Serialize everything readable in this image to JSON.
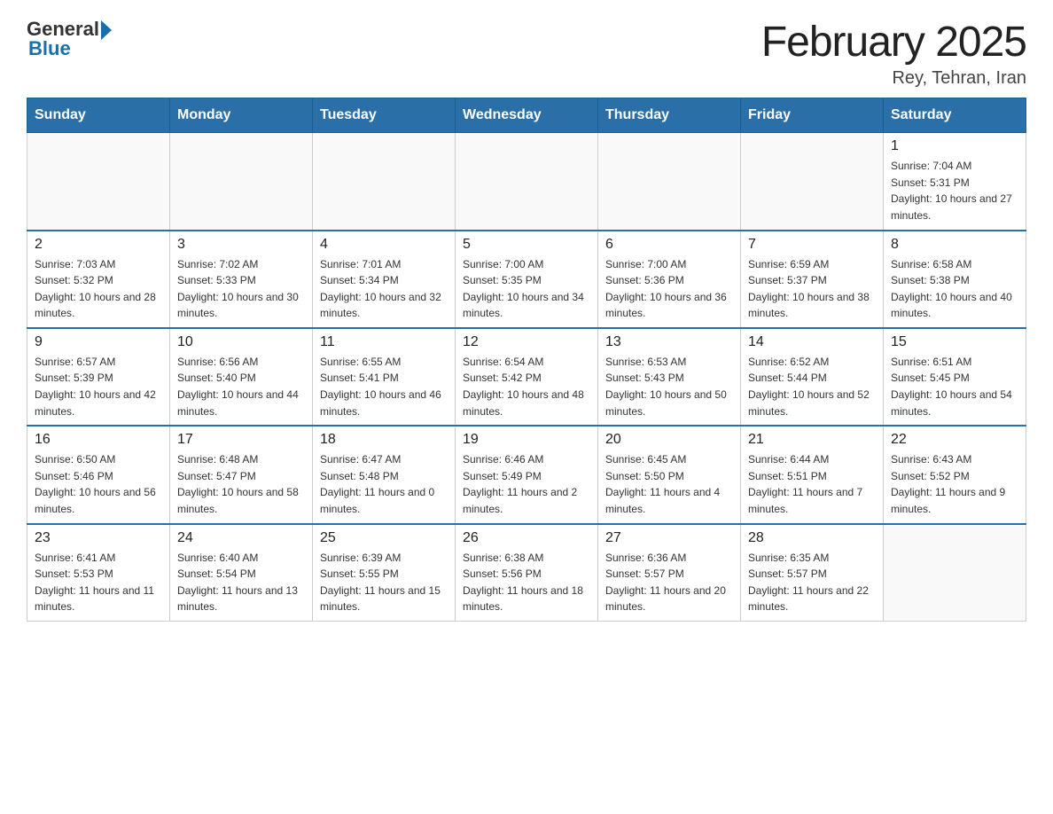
{
  "logo": {
    "general": "General",
    "blue": "Blue"
  },
  "title": "February 2025",
  "subtitle": "Rey, Tehran, Iran",
  "weekdays": [
    "Sunday",
    "Monday",
    "Tuesday",
    "Wednesday",
    "Thursday",
    "Friday",
    "Saturday"
  ],
  "weeks": [
    [
      {
        "day": "",
        "info": ""
      },
      {
        "day": "",
        "info": ""
      },
      {
        "day": "",
        "info": ""
      },
      {
        "day": "",
        "info": ""
      },
      {
        "day": "",
        "info": ""
      },
      {
        "day": "",
        "info": ""
      },
      {
        "day": "1",
        "info": "Sunrise: 7:04 AM\nSunset: 5:31 PM\nDaylight: 10 hours and 27 minutes."
      }
    ],
    [
      {
        "day": "2",
        "info": "Sunrise: 7:03 AM\nSunset: 5:32 PM\nDaylight: 10 hours and 28 minutes."
      },
      {
        "day": "3",
        "info": "Sunrise: 7:02 AM\nSunset: 5:33 PM\nDaylight: 10 hours and 30 minutes."
      },
      {
        "day": "4",
        "info": "Sunrise: 7:01 AM\nSunset: 5:34 PM\nDaylight: 10 hours and 32 minutes."
      },
      {
        "day": "5",
        "info": "Sunrise: 7:00 AM\nSunset: 5:35 PM\nDaylight: 10 hours and 34 minutes."
      },
      {
        "day": "6",
        "info": "Sunrise: 7:00 AM\nSunset: 5:36 PM\nDaylight: 10 hours and 36 minutes."
      },
      {
        "day": "7",
        "info": "Sunrise: 6:59 AM\nSunset: 5:37 PM\nDaylight: 10 hours and 38 minutes."
      },
      {
        "day": "8",
        "info": "Sunrise: 6:58 AM\nSunset: 5:38 PM\nDaylight: 10 hours and 40 minutes."
      }
    ],
    [
      {
        "day": "9",
        "info": "Sunrise: 6:57 AM\nSunset: 5:39 PM\nDaylight: 10 hours and 42 minutes."
      },
      {
        "day": "10",
        "info": "Sunrise: 6:56 AM\nSunset: 5:40 PM\nDaylight: 10 hours and 44 minutes."
      },
      {
        "day": "11",
        "info": "Sunrise: 6:55 AM\nSunset: 5:41 PM\nDaylight: 10 hours and 46 minutes."
      },
      {
        "day": "12",
        "info": "Sunrise: 6:54 AM\nSunset: 5:42 PM\nDaylight: 10 hours and 48 minutes."
      },
      {
        "day": "13",
        "info": "Sunrise: 6:53 AM\nSunset: 5:43 PM\nDaylight: 10 hours and 50 minutes."
      },
      {
        "day": "14",
        "info": "Sunrise: 6:52 AM\nSunset: 5:44 PM\nDaylight: 10 hours and 52 minutes."
      },
      {
        "day": "15",
        "info": "Sunrise: 6:51 AM\nSunset: 5:45 PM\nDaylight: 10 hours and 54 minutes."
      }
    ],
    [
      {
        "day": "16",
        "info": "Sunrise: 6:50 AM\nSunset: 5:46 PM\nDaylight: 10 hours and 56 minutes."
      },
      {
        "day": "17",
        "info": "Sunrise: 6:48 AM\nSunset: 5:47 PM\nDaylight: 10 hours and 58 minutes."
      },
      {
        "day": "18",
        "info": "Sunrise: 6:47 AM\nSunset: 5:48 PM\nDaylight: 11 hours and 0 minutes."
      },
      {
        "day": "19",
        "info": "Sunrise: 6:46 AM\nSunset: 5:49 PM\nDaylight: 11 hours and 2 minutes."
      },
      {
        "day": "20",
        "info": "Sunrise: 6:45 AM\nSunset: 5:50 PM\nDaylight: 11 hours and 4 minutes."
      },
      {
        "day": "21",
        "info": "Sunrise: 6:44 AM\nSunset: 5:51 PM\nDaylight: 11 hours and 7 minutes."
      },
      {
        "day": "22",
        "info": "Sunrise: 6:43 AM\nSunset: 5:52 PM\nDaylight: 11 hours and 9 minutes."
      }
    ],
    [
      {
        "day": "23",
        "info": "Sunrise: 6:41 AM\nSunset: 5:53 PM\nDaylight: 11 hours and 11 minutes."
      },
      {
        "day": "24",
        "info": "Sunrise: 6:40 AM\nSunset: 5:54 PM\nDaylight: 11 hours and 13 minutes."
      },
      {
        "day": "25",
        "info": "Sunrise: 6:39 AM\nSunset: 5:55 PM\nDaylight: 11 hours and 15 minutes."
      },
      {
        "day": "26",
        "info": "Sunrise: 6:38 AM\nSunset: 5:56 PM\nDaylight: 11 hours and 18 minutes."
      },
      {
        "day": "27",
        "info": "Sunrise: 6:36 AM\nSunset: 5:57 PM\nDaylight: 11 hours and 20 minutes."
      },
      {
        "day": "28",
        "info": "Sunrise: 6:35 AM\nSunset: 5:57 PM\nDaylight: 11 hours and 22 minutes."
      },
      {
        "day": "",
        "info": ""
      }
    ]
  ]
}
